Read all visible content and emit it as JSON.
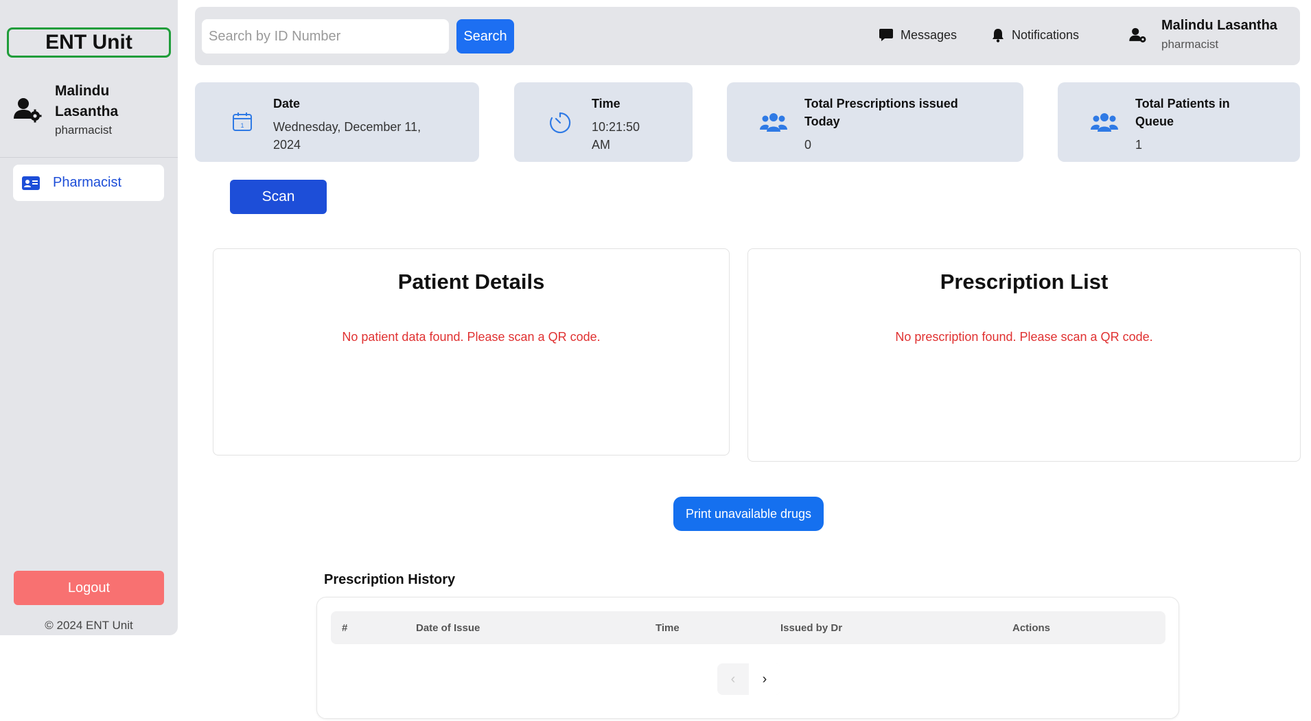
{
  "sidebar": {
    "brand": "ENT Unit",
    "user": {
      "first_name": "Malindu",
      "last_name": "Lasantha",
      "role": "pharmacist"
    },
    "nav": [
      {
        "label": "Pharmacist",
        "icon": "id-card-icon",
        "active": true
      }
    ],
    "logout_label": "Logout",
    "copyright": "© 2024 ENT Unit"
  },
  "topbar": {
    "search": {
      "placeholder": "Search by ID Number",
      "value": "",
      "button_label": "Search"
    },
    "messages_label": "Messages",
    "notifications_label": "Notifications",
    "user": {
      "name": "Malindu Lasantha",
      "role": "pharmacist"
    }
  },
  "stats": {
    "date": {
      "title": "Date",
      "line1": "Wednesday, December 11,",
      "line2": "2024"
    },
    "time": {
      "title": "Time",
      "line1": "10:21:50",
      "line2": "AM"
    },
    "prescriptions": {
      "title_line1": "Total Prescriptions issued",
      "title_line2": "Today",
      "value": "0"
    },
    "queue": {
      "title_line1": "Total Patients in",
      "title_line2": "Queue",
      "value": "1"
    }
  },
  "scan_label": "Scan",
  "patient_panel": {
    "title": "Patient Details",
    "message": "No patient data found. Please scan a QR code."
  },
  "prescription_panel": {
    "title": "Prescription List",
    "message": "No prescription found. Please scan a QR code."
  },
  "print_label": "Print unavailable drugs",
  "history": {
    "title": "Prescription History",
    "columns": [
      "#",
      "Date of Issue",
      "Time",
      "Issued by Dr",
      "Actions"
    ],
    "rows": [],
    "pager": {
      "prev": "‹",
      "next": "›"
    }
  },
  "colors": {
    "accent": "#1d6ff2",
    "brand_border": "#1f9d3a",
    "logout": "#f87171",
    "error": "#e03131",
    "card_bg": "#dfe4ed"
  }
}
